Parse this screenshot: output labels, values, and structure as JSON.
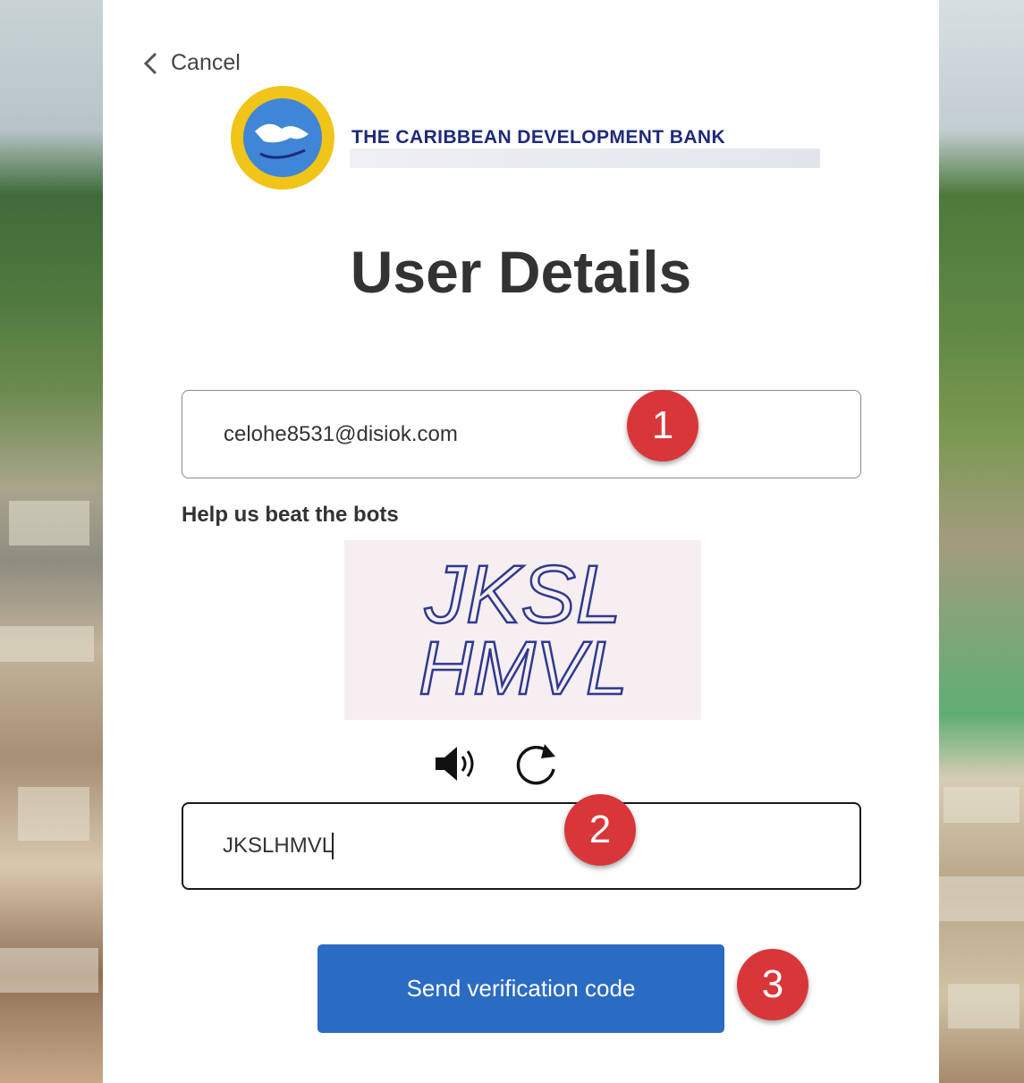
{
  "nav": {
    "cancel_label": "Cancel"
  },
  "brand": {
    "name": "THE CARIBBEAN DEVELOPMENT BANK",
    "seal_color": "#f0c419",
    "title_color": "#1f2a7a"
  },
  "page": {
    "title": "User Details"
  },
  "form": {
    "email_value": "celohe8531@disiok.com",
    "captcha_label": "Help us beat the bots",
    "captcha_text_line1": "JKSL",
    "captcha_text_line2": "HMVL",
    "captcha_audio_icon": "speaker-icon",
    "captcha_refresh_icon": "refresh-icon",
    "code_value": "JKSLHMVL",
    "submit_label": "Send verification code",
    "submit_color": "#2a6bc4"
  },
  "annotations": {
    "badge1": "1",
    "badge2": "2",
    "badge3": "3",
    "badge_color": "#d9363a"
  }
}
